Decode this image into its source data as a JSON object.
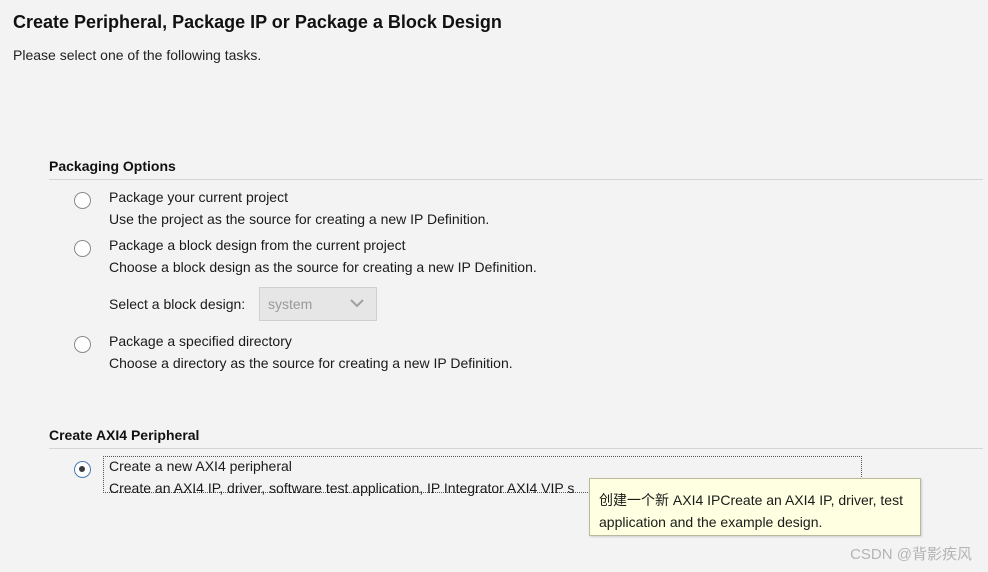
{
  "header": {
    "title": "Create Peripheral, Package IP or Package a Block Design",
    "subtitle": "Please select one of the following tasks."
  },
  "packaging": {
    "header": "Packaging Options",
    "options": [
      {
        "label": "Package your current project",
        "description": "Use the project as the source for creating a new IP Definition.",
        "selected": false
      },
      {
        "label": "Package a block design from the current project",
        "description": "Choose a block design as the source for creating a new IP Definition.",
        "selected": false
      },
      {
        "label": "Package a specified directory",
        "description": "Choose a directory as the source for creating a new IP Definition.",
        "selected": false
      }
    ],
    "block_design": {
      "label": "Select a block design:",
      "value": "system"
    }
  },
  "axi": {
    "header": "Create AXI4 Peripheral",
    "option": {
      "label": "Create a new AXI4 peripheral",
      "description": "Create an AXI4 IP, driver, software test application, IP Integrator AXI4 VIP s",
      "selected": true
    }
  },
  "tooltip": {
    "text": "创建一个新 AXI4 IPCreate an AXI4 IP, driver, test application and the example design."
  },
  "watermark": "CSDN @背影疾风",
  "colors": {
    "background": "#f3f3f3",
    "tooltip_bg": "#ffffe1",
    "radio_selected_ring": "#4a7ab5"
  }
}
